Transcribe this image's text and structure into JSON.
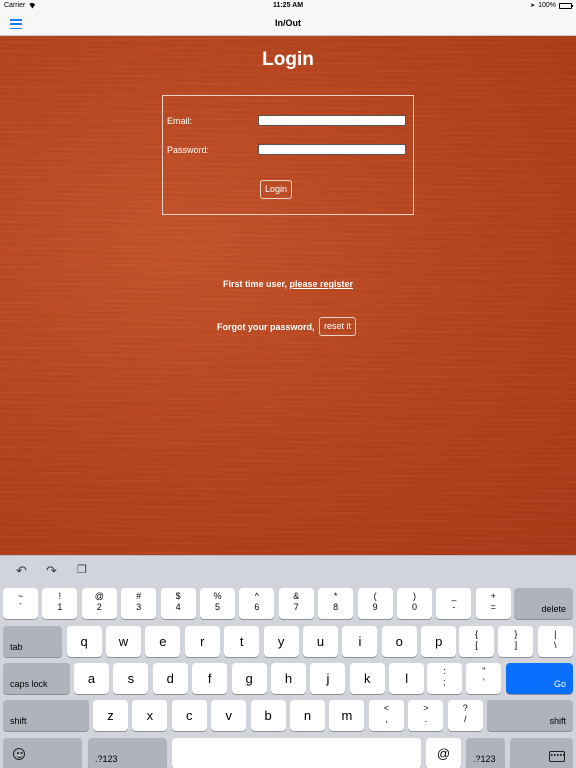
{
  "status_bar": {
    "carrier": "Carrier",
    "time": "11:25 AM",
    "battery": "100%",
    "battery_level": 1.0
  },
  "nav": {
    "title": "In/Out",
    "menu_icon": "hamburger-menu-icon"
  },
  "login": {
    "title": "Login",
    "email_label": "Email:",
    "password_label": "Password:",
    "email_value": "",
    "password_value": "",
    "login_button": "Login"
  },
  "register": {
    "prefix": "First time user,",
    "link": "please register"
  },
  "forgot": {
    "text": "Forgot your password,",
    "button": "reset it"
  },
  "keyboard": {
    "toolbar": [
      "undo-icon",
      "redo-icon",
      "paste-icon"
    ],
    "number_row": [
      {
        "top": "~",
        "bot": "`"
      },
      {
        "top": "!",
        "bot": "1"
      },
      {
        "top": "@",
        "bot": "2"
      },
      {
        "top": "#",
        "bot": "3"
      },
      {
        "top": "$",
        "bot": "4"
      },
      {
        "top": "%",
        "bot": "5"
      },
      {
        "top": "^",
        "bot": "6"
      },
      {
        "top": "&",
        "bot": "7"
      },
      {
        "top": "*",
        "bot": "8"
      },
      {
        "top": "(",
        "bot": "9"
      },
      {
        "top": ")",
        "bot": "0"
      },
      {
        "top": "_",
        "bot": "-"
      },
      {
        "top": "+",
        "bot": "="
      }
    ],
    "delete": "delete",
    "tab": "tab",
    "row_q": [
      "q",
      "w",
      "e",
      "r",
      "t",
      "y",
      "u",
      "i",
      "o",
      "p"
    ],
    "row_q_sym": [
      {
        "top": "{",
        "bot": "["
      },
      {
        "top": "}",
        "bot": "]"
      },
      {
        "top": "|",
        "bot": "\\"
      }
    ],
    "caps": "caps lock",
    "row_a": [
      "a",
      "s",
      "d",
      "f",
      "g",
      "h",
      "j",
      "k",
      "l"
    ],
    "row_a_sym": [
      {
        "top": ":",
        "bot": ";"
      },
      {
        "top": "\"",
        "bot": "'"
      }
    ],
    "go": "Go",
    "shift": "shift",
    "row_z": [
      "z",
      "x",
      "c",
      "v",
      "b",
      "n",
      "m"
    ],
    "row_z_sym": [
      {
        "top": "<",
        "bot": ","
      },
      {
        "top": ">",
        "bot": "."
      },
      {
        "top": "?",
        "bot": "/"
      }
    ],
    "numbers_key": ".?123",
    "at_key": "@",
    "space": "",
    "go_color": "#0a6efc"
  }
}
